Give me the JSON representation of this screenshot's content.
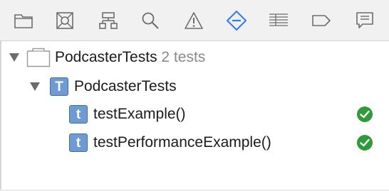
{
  "toolbar": {
    "icons": [
      "project-navigator-icon",
      "source-control-icon",
      "symbol-navigator-icon",
      "find-navigator-icon",
      "issue-navigator-icon",
      "test-navigator-icon",
      "debug-navigator-icon",
      "breakpoint-navigator-icon",
      "report-navigator-icon"
    ],
    "accent": "#3478f6",
    "icon_color": "#6d6d6d"
  },
  "tree": {
    "project": {
      "name": "PodcasterTests",
      "count": "2 tests"
    },
    "target": {
      "name": "PodcasterTests",
      "icon_letter": "T"
    },
    "tests": [
      {
        "name": "testExample()",
        "icon_letter": "t",
        "status": "passed"
      },
      {
        "name": "testPerformanceExample()",
        "icon_letter": "t",
        "status": "passed"
      }
    ]
  },
  "colors": {
    "test_icon_fill": "#6f9bd3",
    "pass_green": "#2e9a3a",
    "count_gray": "#8a8a8a"
  }
}
